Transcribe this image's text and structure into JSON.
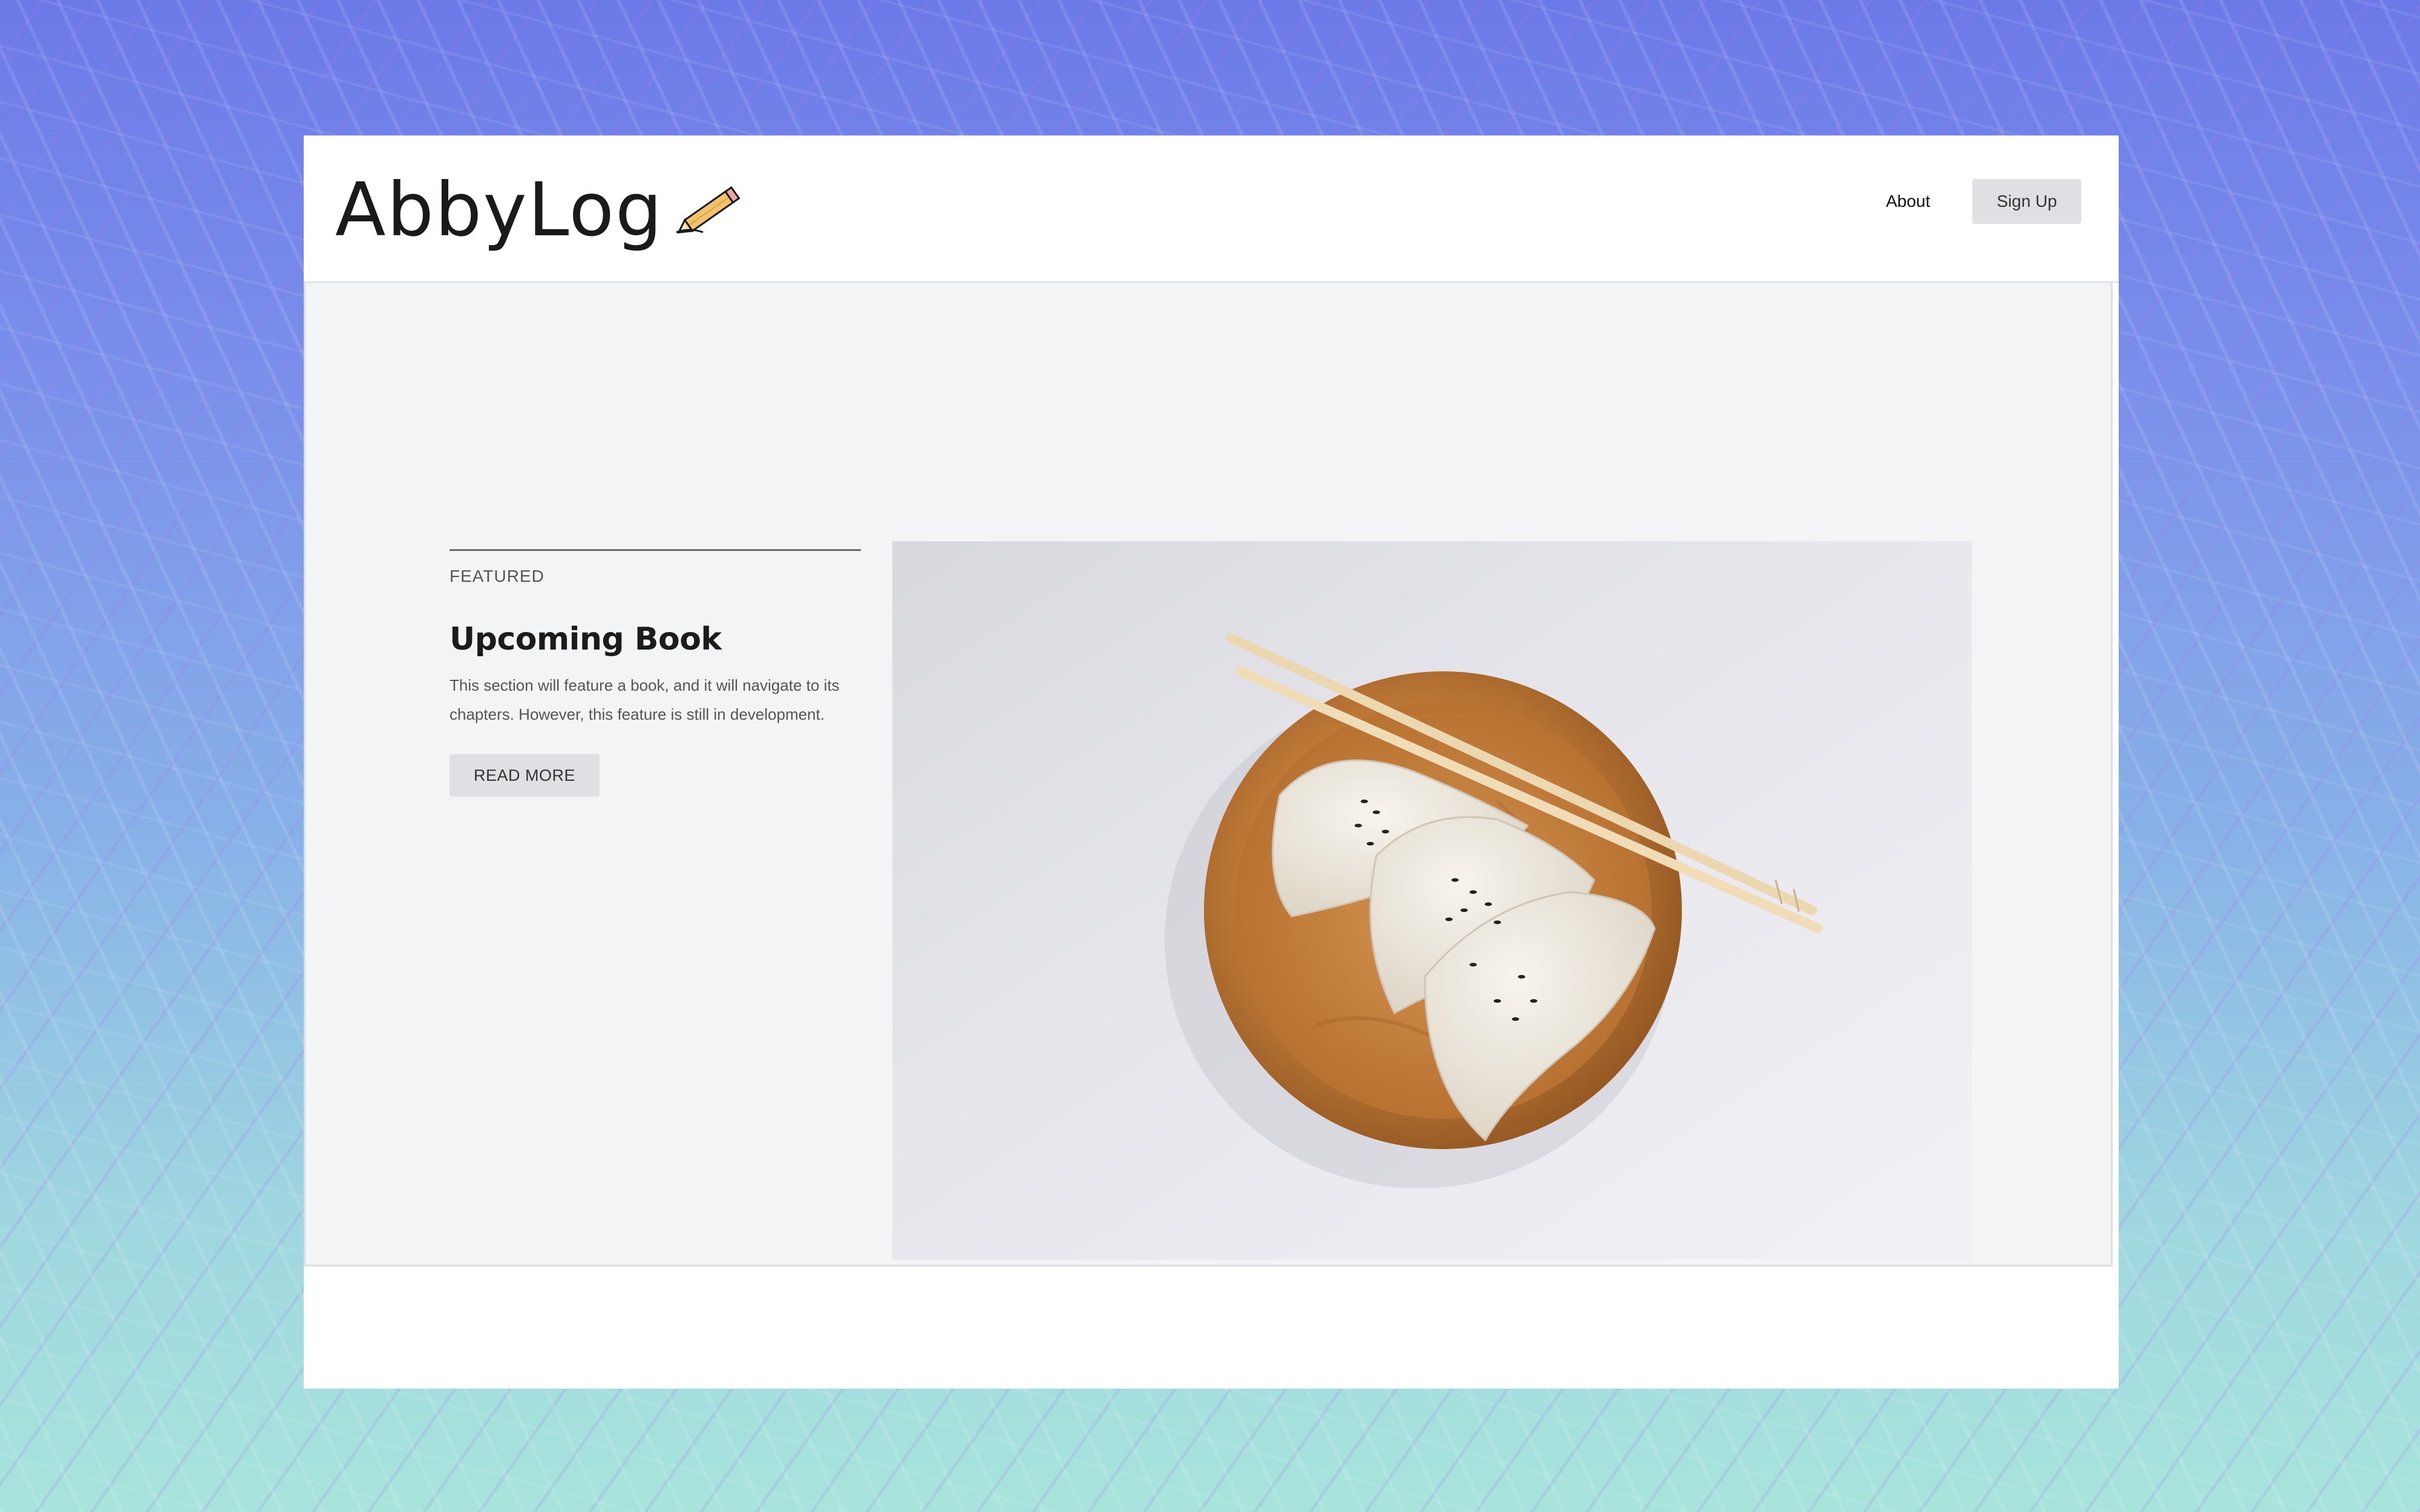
{
  "app": {
    "logo_text": "AbbyLog"
  },
  "nav": {
    "about_label": "About",
    "signup_label": "Sign Up"
  },
  "featured": {
    "tag": "FEATURED",
    "title": "Upcoming Book",
    "description": "This section will feature a book, and it will navigate to its chapters. However, this feature is still in development.",
    "button_label": "READ MORE"
  },
  "colors": {
    "header_bg": "#ffffff",
    "main_bg": "#f3f4f6",
    "button_bg": "#dfe0e3",
    "background_top": "#6c7ae8",
    "background_bottom": "#a8e4dc"
  },
  "icons": {
    "logo_icon": "pencil-icon"
  }
}
